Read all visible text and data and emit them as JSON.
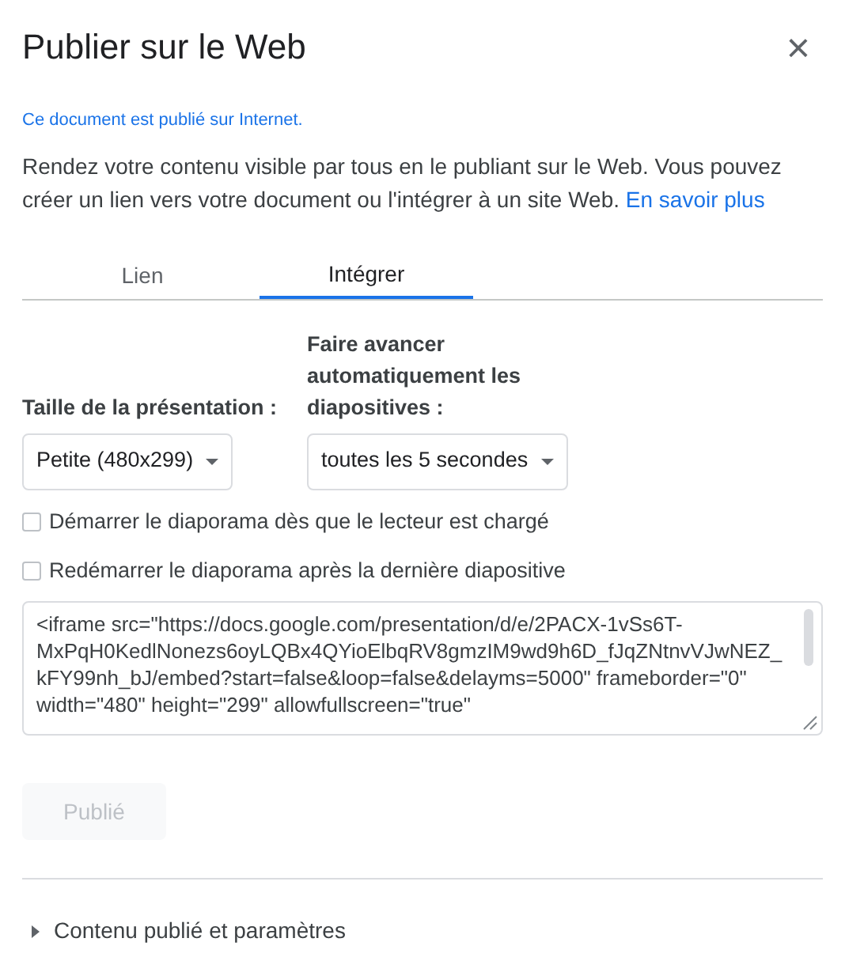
{
  "dialog": {
    "title": "Publier sur le Web",
    "close": "×"
  },
  "status": "Ce document est publié sur Internet.",
  "description": {
    "text": "Rendez votre contenu visible par tous en le publiant sur le Web. Vous pouvez créer un lien vers votre document ou l'intégrer à un site Web.",
    "link": "En savoir plus"
  },
  "tabs": [
    {
      "label": "Lien",
      "selected": false
    },
    {
      "label": "Intégrer",
      "selected": true
    }
  ],
  "selects": [
    {
      "label": "Taille de la présentation :",
      "value": "Petite (480x299)"
    },
    {
      "label": "Faire avancer automatiquement les diapositives :",
      "value": "toutes les 5 secondes"
    }
  ],
  "checkboxes": [
    {
      "label": "Démarrer le diaporama dès que le lecteur est chargé",
      "checked": false
    },
    {
      "label": "Redémarrer le diaporama après la dernière diapositive",
      "checked": false
    }
  ],
  "embed_code": "<iframe src=\"https://docs.google.com/presentation/d/e/2PACX-1vSs6T-MxPqH0KedlNonezs6oyLQBx4QYioElbqRV8gmzIM9wd9h6D_fJqZNtnvVJwNEZ_kFY99nh_bJ/embed?start=false&loop=false&delayms=5000\" frameborder=\"0\" width=\"480\" height=\"299\" allowfullscreen=\"true\"",
  "publish_button": {
    "label": "Publié",
    "disabled": true
  },
  "expander": {
    "label": "Contenu publié et paramètres",
    "expanded": false
  }
}
